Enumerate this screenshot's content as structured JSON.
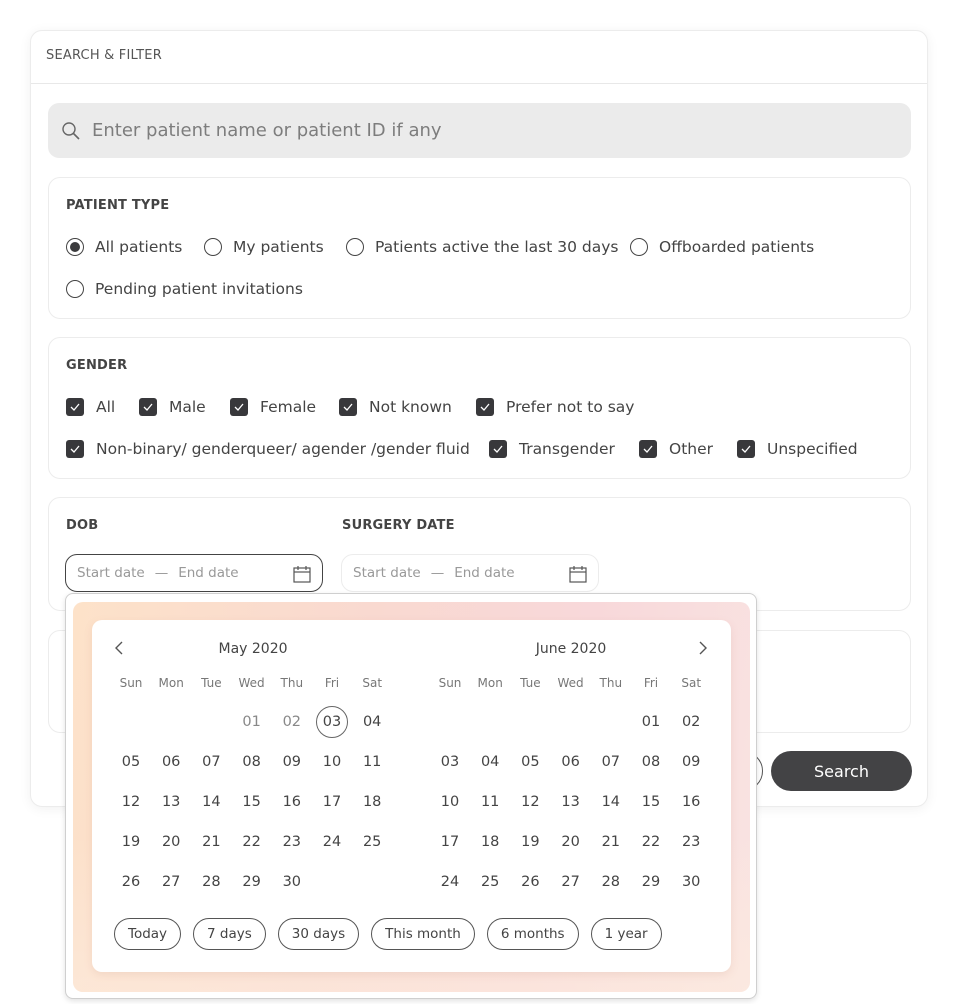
{
  "panel": {
    "title": "SEARCH & FILTER"
  },
  "search": {
    "placeholder": "Enter patient name or patient ID if any",
    "value": ""
  },
  "patient_type": {
    "title": "PATIENT TYPE",
    "options": [
      {
        "label": "All patients",
        "selected": true
      },
      {
        "label": "My patients",
        "selected": false
      },
      {
        "label": "Patients active the last 30 days",
        "selected": false
      },
      {
        "label": "Offboarded patients",
        "selected": false
      },
      {
        "label": "Pending patient invitations",
        "selected": false
      }
    ]
  },
  "gender": {
    "title": "GENDER",
    "options": [
      {
        "label": "All",
        "checked": true
      },
      {
        "label": "Male",
        "checked": true
      },
      {
        "label": "Female",
        "checked": true
      },
      {
        "label": "Not known",
        "checked": true
      },
      {
        "label": "Prefer not to say",
        "checked": true
      },
      {
        "label": "Non-binary/ genderqueer/ agender /gender fluid",
        "checked": true
      },
      {
        "label": "Transgender",
        "checked": true
      },
      {
        "label": "Other",
        "checked": true
      },
      {
        "label": "Unspecified",
        "checked": true
      }
    ]
  },
  "dob": {
    "title": "DOB",
    "start_placeholder": "Start date",
    "end_placeholder": "End date",
    "separator": "—"
  },
  "surgery_date": {
    "title": "SURGERY DATE",
    "start_placeholder": "Start date",
    "end_placeholder": "End date",
    "separator": "—"
  },
  "actions": {
    "search_label": "Search"
  },
  "calendar": {
    "weekdays": [
      "Sun",
      "Mon",
      "Tue",
      "Wed",
      "Thu",
      "Fri",
      "Sat"
    ],
    "months": [
      {
        "title": "May 2020",
        "first_weekday": 3,
        "days": [
          "01",
          "02",
          "03",
          "04",
          "05",
          "06",
          "07",
          "08",
          "09",
          "10",
          "11",
          "12",
          "13",
          "14",
          "15",
          "16",
          "17",
          "18",
          "19",
          "20",
          "21",
          "22",
          "23",
          "24",
          "25",
          "26",
          "27",
          "28",
          "29",
          "30"
        ],
        "muted_days": [
          "01",
          "02"
        ],
        "today": "03"
      },
      {
        "title": "June 2020",
        "first_weekday": 5,
        "days": [
          "01",
          "02",
          "03",
          "04",
          "05",
          "06",
          "07",
          "08",
          "09",
          "10",
          "11",
          "12",
          "13",
          "14",
          "15",
          "16",
          "17",
          "18",
          "19",
          "20",
          "21",
          "22",
          "23",
          "24",
          "25",
          "26",
          "27",
          "28",
          "29",
          "30"
        ],
        "muted_days": [],
        "today": null
      }
    ],
    "presets": [
      "Today",
      "7 days",
      "30 days",
      "This month",
      "6 months",
      "1 year"
    ],
    "gradient_colors": [
      "#fde2c9",
      "#f8d8da"
    ]
  }
}
